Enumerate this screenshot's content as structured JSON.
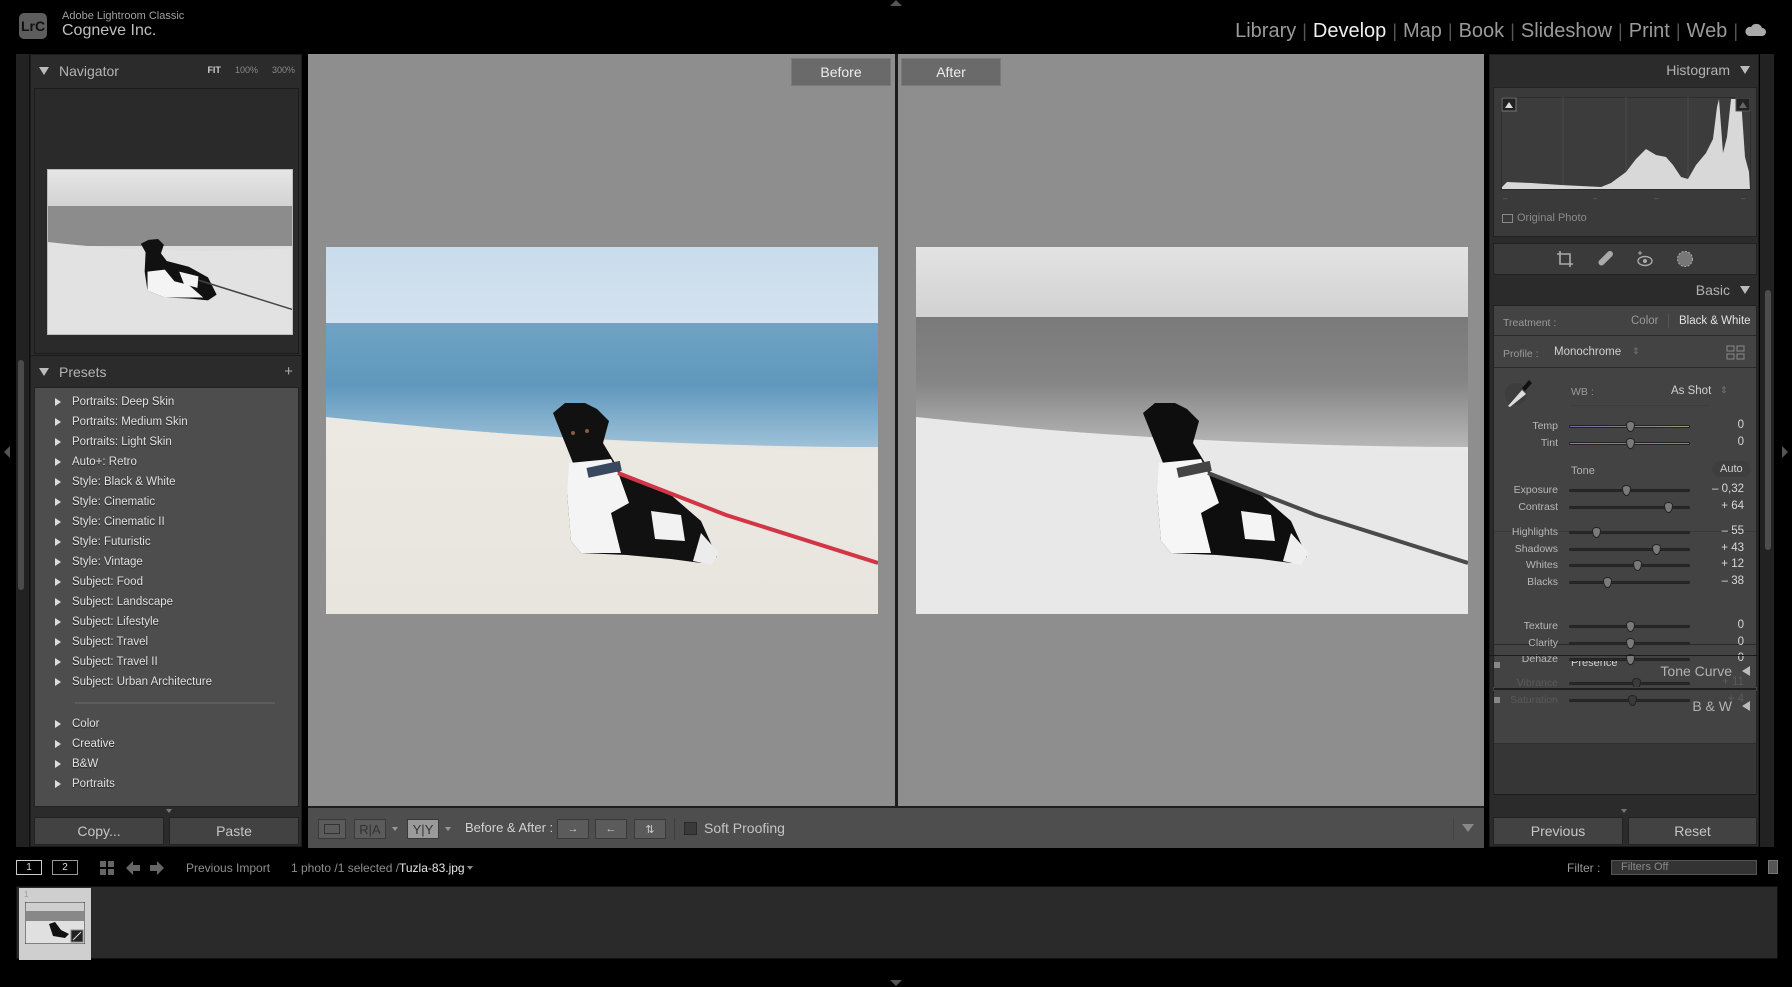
{
  "app": {
    "logo": "LrC",
    "name": "Adobe Lightroom Classic",
    "org": "Cogneve Inc."
  },
  "modules": [
    {
      "label": "Library",
      "active": false
    },
    {
      "label": "Develop",
      "active": true
    },
    {
      "label": "Map",
      "active": false
    },
    {
      "label": "Book",
      "active": false
    },
    {
      "label": "Slideshow",
      "active": false
    },
    {
      "label": "Print",
      "active": false
    },
    {
      "label": "Web",
      "active": false
    }
  ],
  "navigator": {
    "title": "Navigator",
    "zoom_fit": "FIT",
    "zoom_100": "100%",
    "zoom_300": "300%"
  },
  "presets": {
    "title": "Presets",
    "add": "+",
    "groups": [
      "Portraits: Deep Skin",
      "Portraits: Medium Skin",
      "Portraits: Light Skin",
      "Auto+: Retro",
      "Style: Black & White",
      "Style: Cinematic",
      "Style: Cinematic II",
      "Style: Futuristic",
      "Style: Vintage",
      "Subject: Food",
      "Subject: Landscape",
      "Subject: Lifestyle",
      "Subject: Travel",
      "Subject: Travel II",
      "Subject: Urban Architecture"
    ],
    "user_groups": [
      "Color",
      "Creative",
      "B&W",
      "Portraits"
    ]
  },
  "left_buttons": {
    "copy": "Copy...",
    "paste": "Paste"
  },
  "view": {
    "before": "Before",
    "after": "After"
  },
  "toolbar": {
    "before_after_label": "Before & After :",
    "soft_proofing": "Soft Proofing",
    "soft_proofing_checked": false,
    "view_ra": "R|A",
    "view_yy": "Y|Y"
  },
  "histogram": {
    "title": "Histogram",
    "original_photo": "Original Photo",
    "original_photo_checked": false
  },
  "tools": [
    "crop-icon",
    "healing-icon",
    "red-eye-icon",
    "mask-icon"
  ],
  "basic": {
    "title": "Basic",
    "treatment_label": "Treatment :",
    "treatment_options": [
      "Color",
      "Black & White"
    ],
    "treatment_selected": "Black & White",
    "profile_label": "Profile :",
    "profile_value": "Monochrome",
    "wb_label": "WB :",
    "wb_value": "As Shot",
    "tone_label": "Tone",
    "auto_label": "Auto",
    "presence_label": "Presence",
    "sliders": {
      "temp": {
        "label": "Temp",
        "value": "0",
        "pos": 0.5
      },
      "tint": {
        "label": "Tint",
        "value": "0",
        "pos": 0.5
      },
      "exposure": {
        "label": "Exposure",
        "value": "– 0,32",
        "pos": 0.468
      },
      "contrast": {
        "label": "Contrast",
        "value": "+ 64",
        "pos": 0.82
      },
      "highlights": {
        "label": "Highlights",
        "value": "– 55",
        "pos": 0.225
      },
      "shadows": {
        "label": "Shadows",
        "value": "+ 43",
        "pos": 0.715
      },
      "whites": {
        "label": "Whites",
        "value": "+ 12",
        "pos": 0.56
      },
      "blacks": {
        "label": "Blacks",
        "value": "– 38",
        "pos": 0.31
      },
      "texture": {
        "label": "Texture",
        "value": "0",
        "pos": 0.5
      },
      "clarity": {
        "label": "Clarity",
        "value": "0",
        "pos": 0.5
      },
      "dehaze": {
        "label": "Dehaze",
        "value": "0",
        "pos": 0.5
      },
      "vibrance": {
        "label": "Vibrance",
        "value": "+ 11",
        "pos": 0.555
      },
      "saturation": {
        "label": "Saturation",
        "value": "+ 4",
        "pos": 0.52
      }
    }
  },
  "collapsed_panels": [
    "Tone Curve",
    "B & W"
  ],
  "right_buttons": {
    "previous": "Previous",
    "reset": "Reset"
  },
  "filmstrip": {
    "page1": "1",
    "page2": "2",
    "source": "Previous Import",
    "count": "1 photo /1 selected /",
    "filename": "Tuzla-83.jpg",
    "filter_label": "Filter :",
    "filter_value": "Filters Off",
    "thumb_index": "1"
  }
}
